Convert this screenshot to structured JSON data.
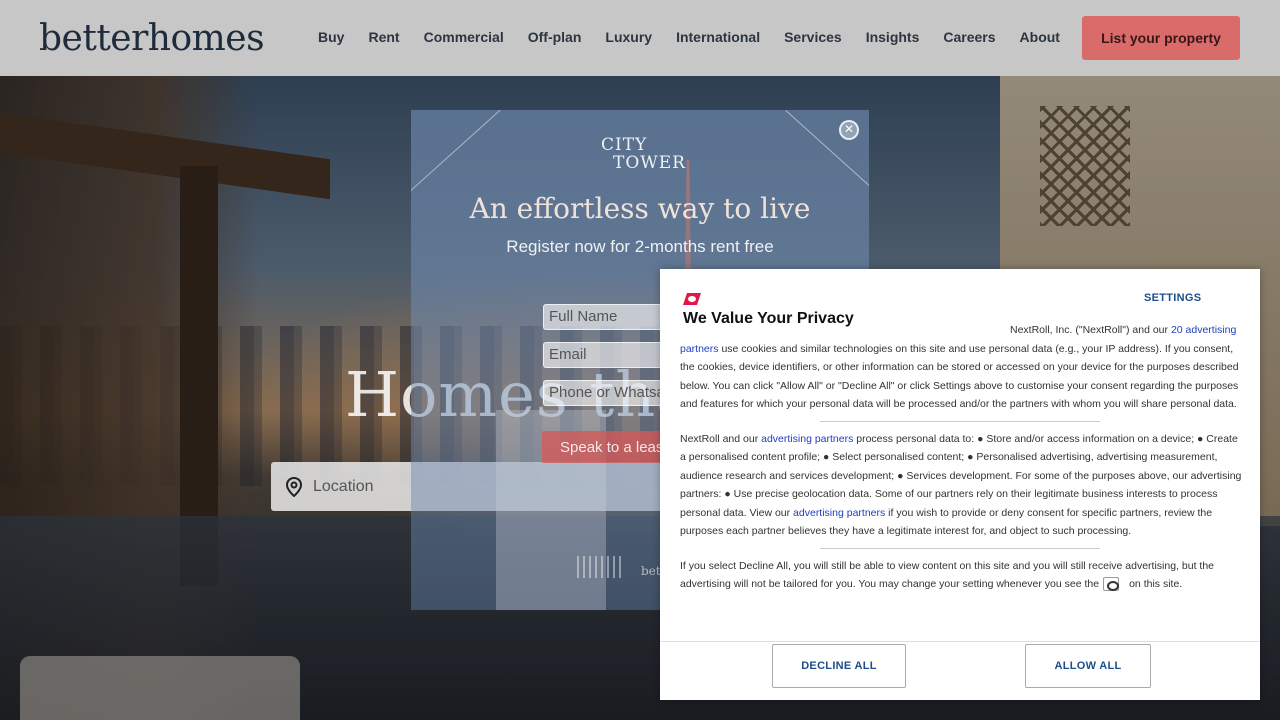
{
  "header": {
    "logo": "betterhomes",
    "nav": [
      "Buy",
      "Rent",
      "Commercial",
      "Off-plan",
      "Luxury",
      "International",
      "Services",
      "Insights",
      "Careers",
      "About"
    ],
    "cta_label": "List your property"
  },
  "hero": {
    "title": "Homes that",
    "search_placeholder": "Location"
  },
  "promo": {
    "brand_line1": "CITY",
    "brand_line2": "TOWER",
    "headline": "An effortless way to live",
    "subheadline": "Register now for 2-months rent free",
    "fields": [
      "Full Name",
      "Email",
      "Phone or Whatsapp"
    ],
    "cta_label": "Speak to a leasing",
    "footer_brand": "bet"
  },
  "privacy": {
    "settings_label": "SETTINGS",
    "title": "We Value Your Privacy",
    "p1_start": "NextRoll, Inc. (\"NextRoll\") and our ",
    "p1_link": "20 advertising partners",
    "p1_rest": " use cookies and similar technologies on this site and use personal data (e.g., your IP address). If you consent, the cookies, device identifiers, or other information can be stored or accessed on your device for the purposes described below. You can click \"Allow All\" or \"Decline All\" or click Settings above to customise your consent regarding the purposes and features for which your personal data will be processed and/or the partners with whom you will share personal data.",
    "p2_start": "NextRoll and our ",
    "p2_link": "advertising partners",
    "p2_mid": " process personal data to: ● Store and/or access information on a device; ● Create a personalised content profile; ● Select personalised content; ● Personalised advertising, advertising measurement, audience research and services development; ● Services development. For some of the purposes above, our advertising partners: ● Use precise geolocation data. Some of our partners rely on their legitimate business interests to process personal data. View our ",
    "p2_link2": "advertising partners",
    "p2_end": " if you wish to provide or deny consent for specific partners, review the purposes each partner believes they have a legitimate interest for, and object to such processing.",
    "p3_start": "If you select Decline All, you will still be able to view content on this site and you will still receive advertising, but the advertising will not be tailored for you. You may change your setting whenever you see the",
    "p3_end": "on this site.",
    "decline_label": "DECLINE ALL",
    "allow_label": "ALLOW ALL"
  },
  "colors": {
    "header_bg": "#c7c7c7",
    "cta": "#d96b6b",
    "link_blue": "#1f3fbf",
    "nextroll_red": "#e0194a"
  }
}
